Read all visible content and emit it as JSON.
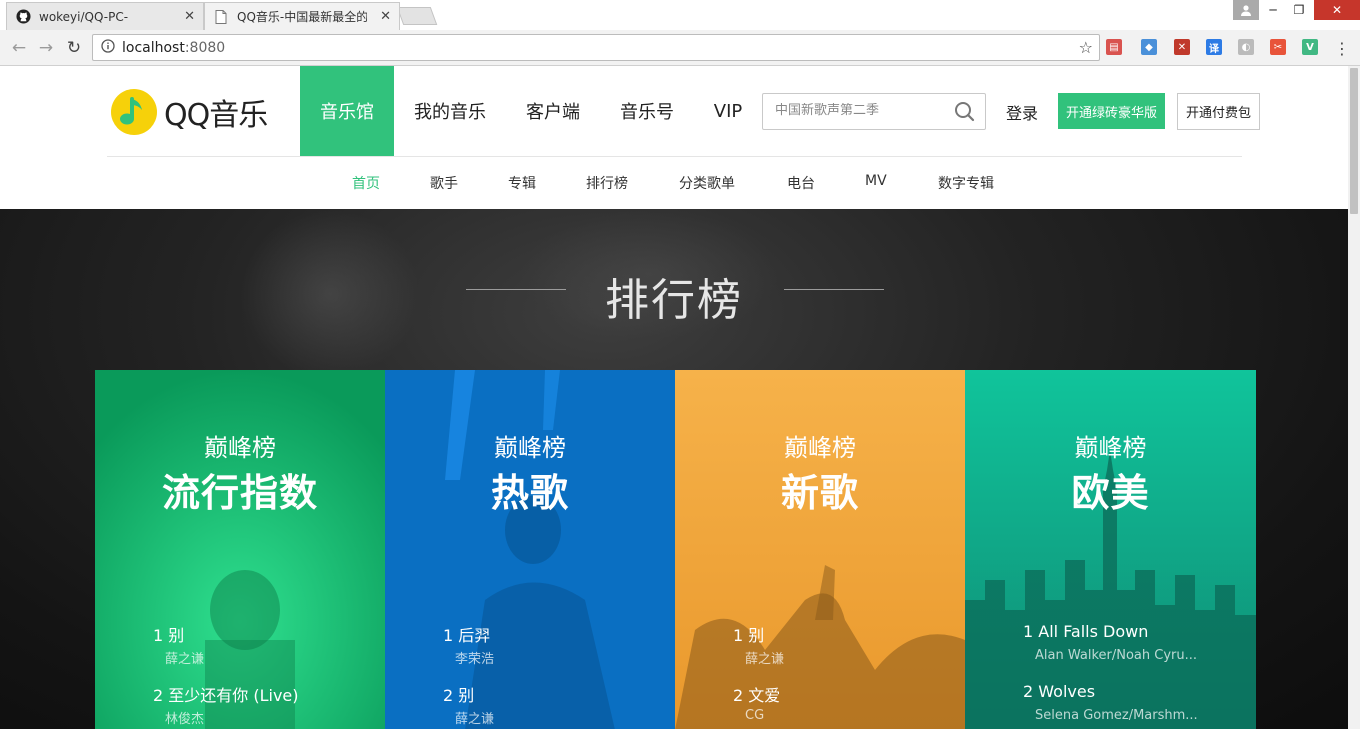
{
  "browser": {
    "tabs": [
      {
        "title": "wokeyi/QQ-PC-",
        "icon": "github-icon"
      },
      {
        "title": "QQ音乐-中国最新最全的",
        "icon": "page-icon"
      }
    ],
    "url": "localhost",
    "port": ":8080",
    "extensions": [
      {
        "name": "calendar-extension-icon",
        "color": "#d9534f",
        "glyph": "▤"
      },
      {
        "name": "chrome-extension-icon",
        "color": "#4a90d9",
        "glyph": "◆"
      },
      {
        "name": "adblock-extension-icon",
        "color": "#c0392b",
        "glyph": "✕"
      },
      {
        "name": "translate-extension-icon",
        "color": "#2d7be5",
        "glyph": "译"
      },
      {
        "name": "leaf-extension-icon",
        "color": "#bbbbbb",
        "glyph": "◐"
      },
      {
        "name": "tools-extension-icon",
        "color": "#e8543a",
        "glyph": "✂"
      },
      {
        "name": "vue-devtools-icon",
        "color": "#41b883",
        "glyph": "V"
      }
    ]
  },
  "header": {
    "logo_text": "QQ音乐",
    "nav": [
      "音乐馆",
      "我的音乐",
      "客户端",
      "音乐号",
      "VIP"
    ],
    "active_nav": "音乐馆",
    "search_placeholder": "中国新歌声第二季",
    "login": "登录",
    "vip_button": "开通绿砖豪华版",
    "pay_button": "开通付费包"
  },
  "subnav": {
    "items": [
      "首页",
      "歌手",
      "专辑",
      "排行榜",
      "分类歌单",
      "电台",
      "MV",
      "数字专辑"
    ],
    "active": "首页"
  },
  "ranking": {
    "title": "排行榜",
    "cards": [
      {
        "subtitle": "巅峰榜",
        "name": "流行指数",
        "color": "#17b36e",
        "songs": [
          {
            "line": "1 别",
            "artist": "薛之谦"
          },
          {
            "line": "2 至少还有你 (Live)",
            "artist": "林俊杰"
          }
        ]
      },
      {
        "subtitle": "巅峰榜",
        "name": "热歌",
        "color": "#0a6fc2",
        "songs": [
          {
            "line": "1 后羿",
            "artist": "李荣浩"
          },
          {
            "line": "2 别",
            "artist": "薛之谦"
          }
        ]
      },
      {
        "subtitle": "巅峰榜",
        "name": "新歌",
        "color": "#f1a53a",
        "songs": [
          {
            "line": "1 别",
            "artist": "薛之谦"
          },
          {
            "line": "2 文爱",
            "artist": "CG"
          }
        ]
      },
      {
        "subtitle": "巅峰榜",
        "name": "欧美",
        "color": "#12a88d",
        "songs": [
          {
            "line": "1 All Falls Down",
            "artist": "Alan Walker/Noah Cyru..."
          },
          {
            "line": "2 Wolves",
            "artist": "Selena Gomez/Marshm..."
          }
        ]
      }
    ]
  }
}
